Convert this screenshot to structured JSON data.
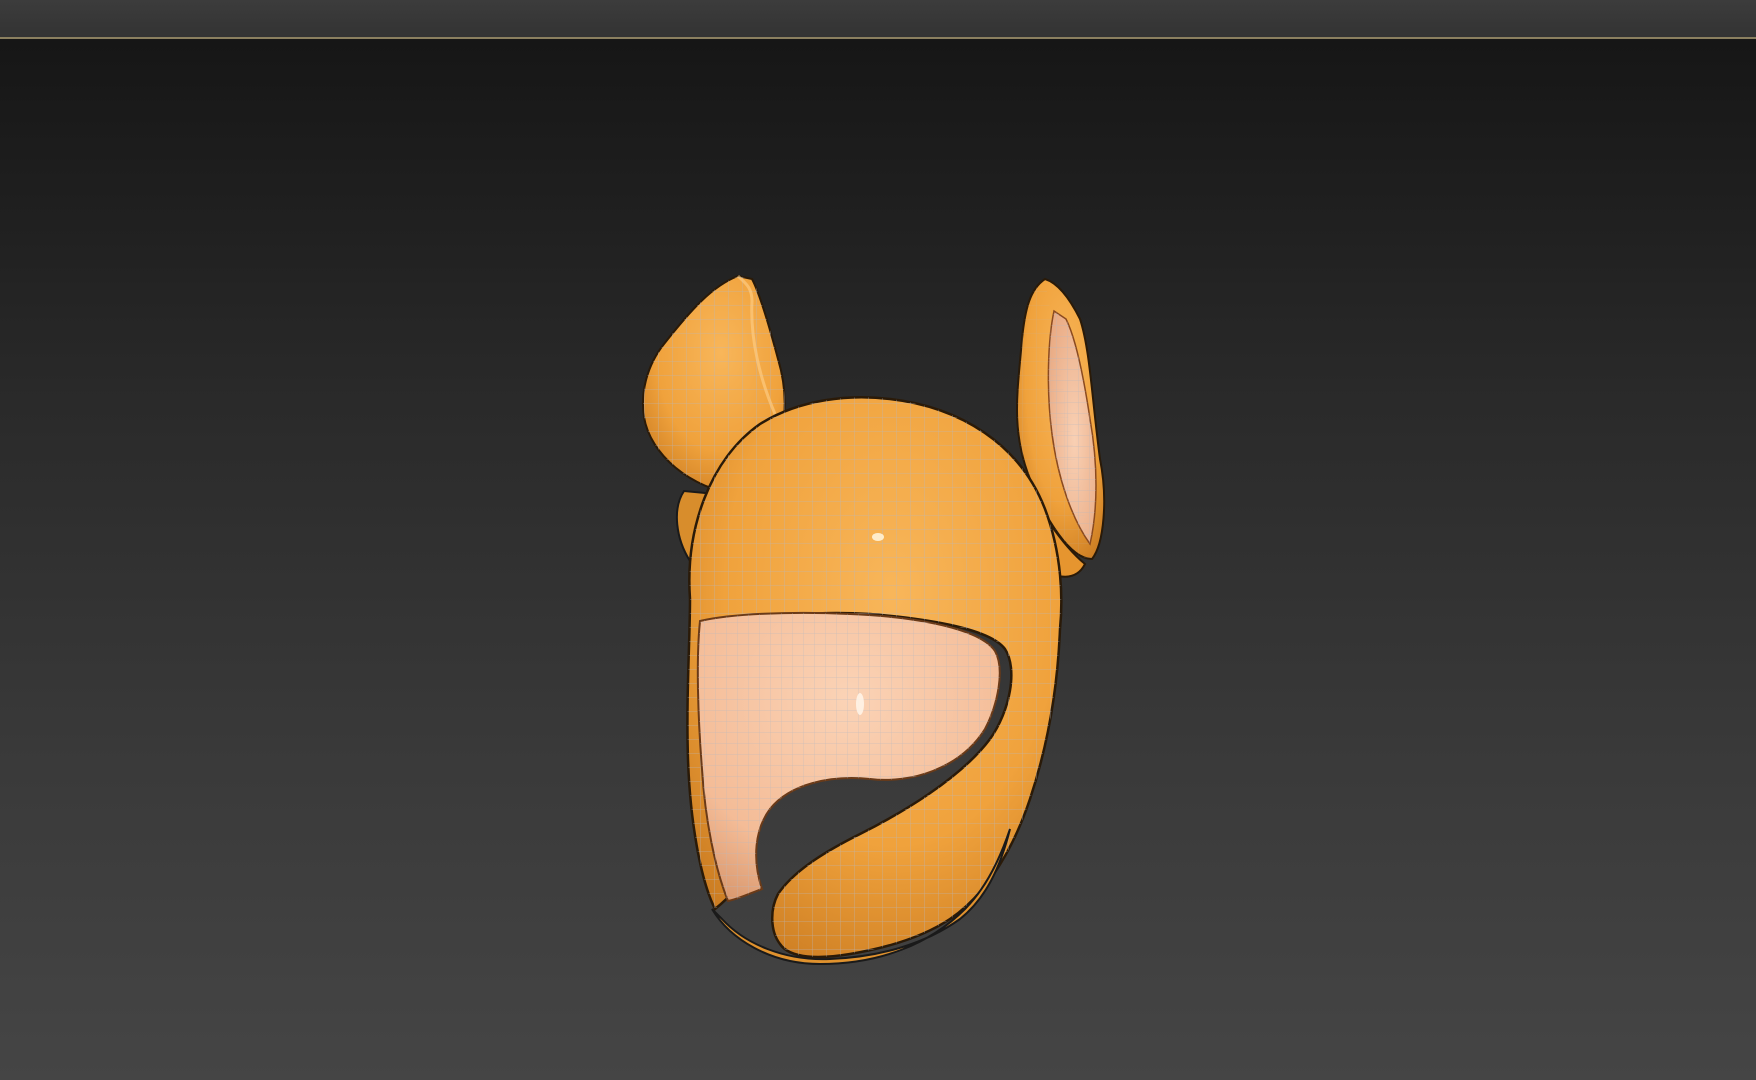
{
  "viewport": {
    "object": "hat-with-ears-mesh",
    "shell_color": "#f2a540",
    "lining_color": "#f6c6a4",
    "wire_color": "#b8b8c0",
    "background_top": "#161616",
    "background_bottom": "#454545",
    "border_accent": "#8a7f5f"
  }
}
